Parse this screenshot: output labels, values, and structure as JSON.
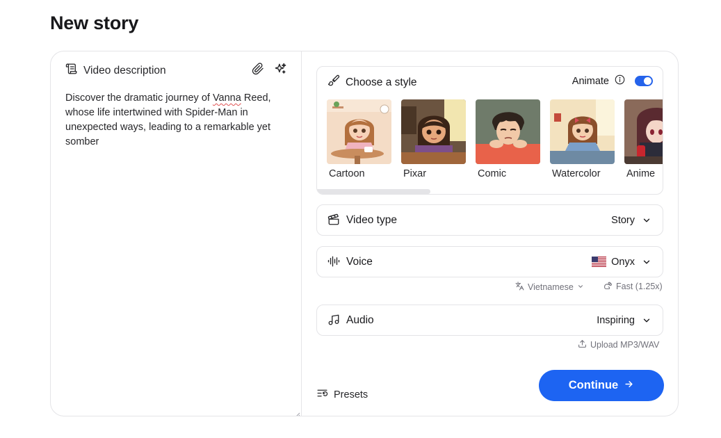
{
  "page": {
    "title": "New story"
  },
  "description": {
    "label": "Video description",
    "text_before": "Discover the dramatic journey of ",
    "text_underlined": "Vanna",
    "text_after": " Reed, whose life intertwined with Spider-Man in unexpected ways, leading to a remarkable yet somber"
  },
  "style": {
    "label": "Choose a style",
    "animate_label": "Animate",
    "animate_on": true,
    "items": [
      {
        "label": "Cartoon"
      },
      {
        "label": "Pixar"
      },
      {
        "label": "Comic"
      },
      {
        "label": "Watercolor"
      },
      {
        "label": "Anime"
      }
    ]
  },
  "video_type": {
    "label": "Video type",
    "value": "Story"
  },
  "voice": {
    "label": "Voice",
    "value": "Onyx",
    "language": "Vietnamese",
    "speed": "Fast (1.25x)"
  },
  "audio": {
    "label": "Audio",
    "value": "Inspiring",
    "upload": "Upload MP3/WAV"
  },
  "presets_label": "Presets",
  "continue_label": "Continue",
  "colors": {
    "accent": "#1d64f2",
    "toggle": "#2563eb",
    "border": "#e4e4e7"
  }
}
